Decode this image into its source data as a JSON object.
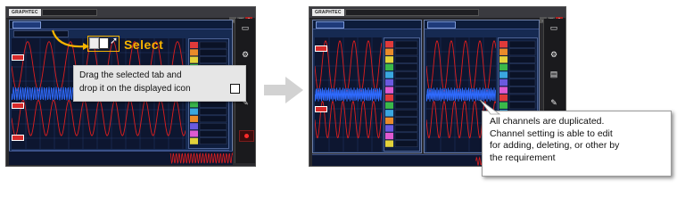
{
  "left_window": {
    "logo": "GRAPHTEC",
    "title": "",
    "tab_label": "",
    "select_label": "Select",
    "instruction_line1": "Drag the selected tab and",
    "instruction_line2": "drop it on the displayed icon",
    "drop_icon": "dual-screen-icon"
  },
  "right_window": {
    "logo": "GRAPHTEC",
    "title": "",
    "note_line1": "All channels are duplicated.",
    "note_line2": "Channel setting is able to edit",
    "note_line3": "for adding, deleting, or other by",
    "note_line4": "the requirement"
  },
  "colors": {
    "accent_orange": "#f6b400",
    "waveform_red": "#e01e1e",
    "waveform_blue": "#2f6bff",
    "panel_bg": "#162a52",
    "arrow_gray": "#cfcfcf"
  },
  "channel_colors": [
    "#e03a3a",
    "#e98b2a",
    "#e2d23a",
    "#3ab84a",
    "#3aa7e0",
    "#6a5ae0",
    "#e05ad0",
    "#e03a3a",
    "#3ab84a",
    "#3aa7e0",
    "#e98b2a",
    "#6a5ae0",
    "#e05ad0",
    "#e2d23a"
  ]
}
